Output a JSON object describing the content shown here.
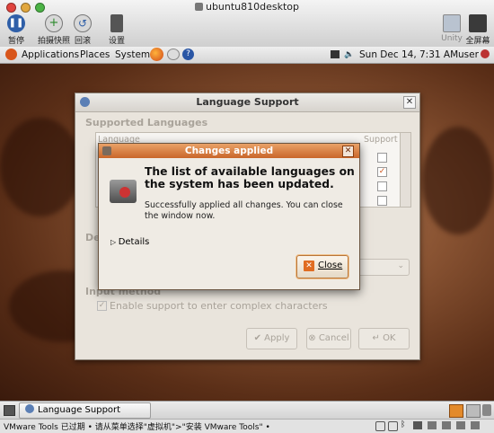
{
  "vmware": {
    "window_title": "ubuntu810desktop",
    "buttons": {
      "pause": "暂停",
      "snapshot": "拍摄快照",
      "revert": "回滚",
      "settings": "设置",
      "unity": "Unity",
      "fullscreen": "全屏幕"
    }
  },
  "panel": {
    "menus": [
      "Applications",
      "Places",
      "System"
    ],
    "datetime": "Sun Dec 14,  7:31 AM",
    "user": "user"
  },
  "lang_window": {
    "title": "Language Support",
    "section_supported": "Supported Languages",
    "col_language": "Language",
    "col_support": "Support",
    "section_default_partial": "De",
    "section_input": "Input method",
    "input_checkbox": "Enable support to enter complex characters",
    "buttons": {
      "apply": "Apply",
      "cancel": "Cancel",
      "ok": "OK"
    }
  },
  "dialog": {
    "title": "Changes applied",
    "heading": "The list of available languages on the system has been updated.",
    "body": "Successfully applied all changes. You can close the window now.",
    "details": "Details",
    "close": "Close"
  },
  "taskbar": {
    "task": "Language Support"
  },
  "status": {
    "message": "VMware Tools 已过期 • 请从菜单选择\"虚拟机\">\"安装 VMware Tools\" •"
  }
}
